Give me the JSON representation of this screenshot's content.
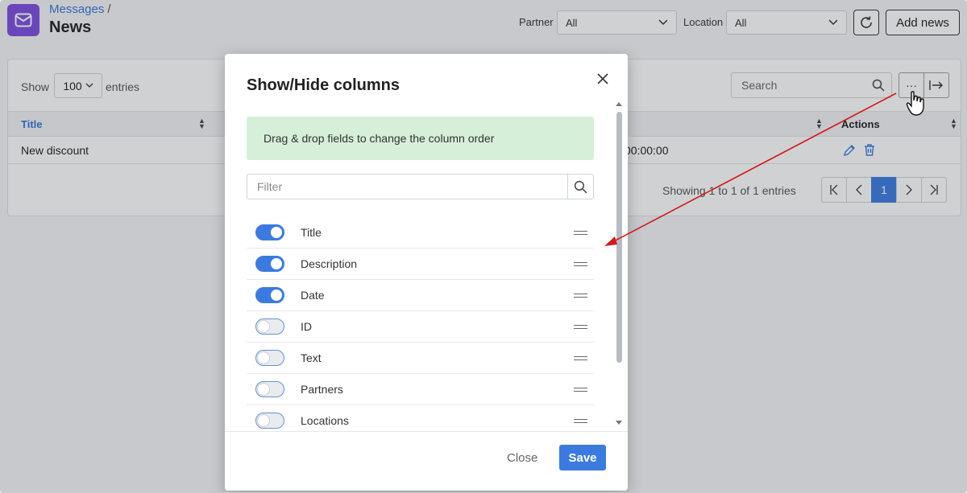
{
  "header": {
    "breadcrumb_parent": "Messages",
    "breadcrumb_sep": "/",
    "title": "News",
    "partner_label": "Partner",
    "partner_value": "All",
    "location_label": "Location",
    "location_value": "All",
    "add_news_label": "Add news"
  },
  "table": {
    "show_label": "Show",
    "page_length": "100",
    "entries_label": "entries",
    "search_placeholder": "Search",
    "more_label": "···",
    "columns": [
      "Title",
      "Actions"
    ],
    "rows": [
      {
        "title": "New discount",
        "date_fragment": "00:00:00"
      }
    ],
    "info": "Showing 1 to 1 of 1 entries",
    "current_page": "1"
  },
  "modal": {
    "title": "Show/Hide columns",
    "hint": "Drag & drop fields to change the column order",
    "filter_placeholder": "Filter",
    "columns": [
      {
        "label": "Title",
        "on": true
      },
      {
        "label": "Description",
        "on": true
      },
      {
        "label": "Date",
        "on": true
      },
      {
        "label": "ID",
        "on": false
      },
      {
        "label": "Text",
        "on": false
      },
      {
        "label": "Partners",
        "on": false
      },
      {
        "label": "Locations",
        "on": false
      }
    ],
    "close_label": "Close",
    "save_label": "Save"
  },
  "colors": {
    "accent": "#3b7be0",
    "logo": "#7b4fe0",
    "hint_bg": "#d6efd9",
    "annotation_arrow": "#d11a1a"
  }
}
